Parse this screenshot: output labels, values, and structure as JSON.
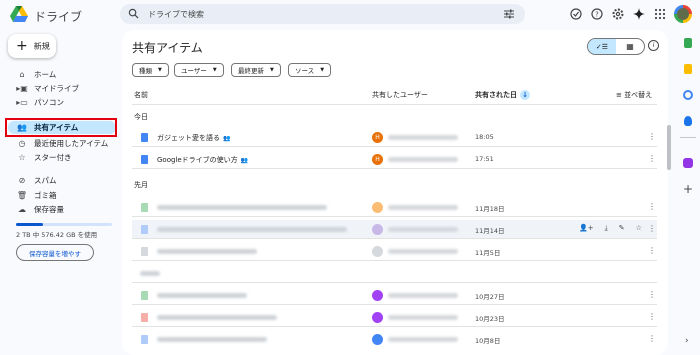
{
  "header": {
    "app_title": "ドライブ",
    "search_placeholder": "ドライブで検索"
  },
  "sidebar": {
    "new_label": "新規",
    "items": [
      {
        "label": "ホーム",
        "icon": "home-icon"
      },
      {
        "label": "マイドライブ",
        "icon": "my-drive-icon"
      },
      {
        "label": "パソコン",
        "icon": "computer-icon"
      },
      {
        "label": "共有アイテム",
        "icon": "shared-icon",
        "active": true
      },
      {
        "label": "最近使用したアイテム",
        "icon": "recent-icon"
      },
      {
        "label": "スター付き",
        "icon": "star-icon"
      },
      {
        "label": "スパム",
        "icon": "spam-icon"
      },
      {
        "label": "ゴミ箱",
        "icon": "trash-icon"
      },
      {
        "label": "保存容量",
        "icon": "cloud-icon"
      }
    ],
    "storage_text": "2 TB 中 576.42 GB を使用",
    "storage_fraction": 0.28,
    "buy_storage_label": "保存容量を増やす"
  },
  "main": {
    "title": "共有アイテム",
    "filters": [
      "種類",
      "ユーザー",
      "最終更新",
      "ソース"
    ],
    "columns": {
      "name": "名前",
      "shared_by": "共有したユーザー",
      "shared_date": "共有された日",
      "sort": "並べ替え"
    },
    "sections": {
      "today": "今日",
      "last_month": "先月"
    },
    "today_rows": [
      {
        "name": "ガジェット愛を語る",
        "avatar": "H",
        "date": "18:05"
      },
      {
        "name": "Googleドライブの使い方",
        "avatar": "H",
        "date": "17:51"
      }
    ],
    "last_month_rows": [
      {
        "date": "11月18日"
      },
      {
        "date": "11月14日"
      },
      {
        "date": "11月5日"
      },
      {
        "date": ""
      },
      {
        "date": "10月27日"
      },
      {
        "date": "10月23日"
      },
      {
        "date": "10月8日"
      }
    ]
  },
  "colors": {
    "accent": "#0b57d0",
    "active_nav": "#c2e7ff",
    "highlight_box": "#e3000f"
  }
}
